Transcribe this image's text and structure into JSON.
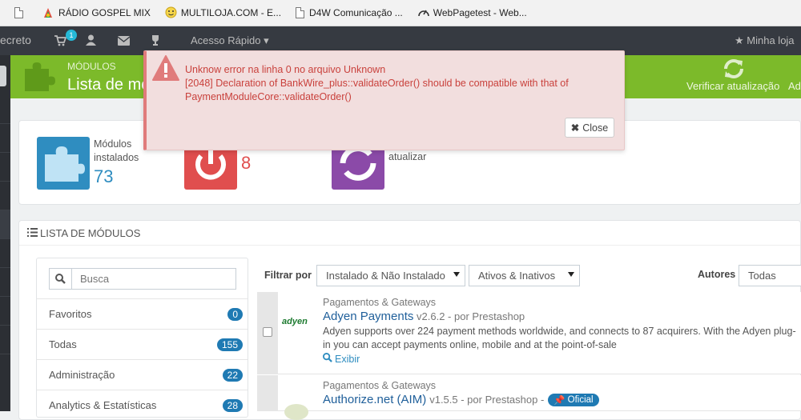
{
  "bookmarks": [
    {
      "label": "",
      "icon": "page-icon"
    },
    {
      "label": "RÁDIO GOSPEL MIX",
      "icon": "colorful-leaf-icon"
    },
    {
      "label": "MULTILOJA.COM - E...",
      "icon": "smiley-icon"
    },
    {
      "label": "D4W Comunicação ...",
      "icon": "page-icon"
    },
    {
      "label": "WebPagetest - Web...",
      "icon": "speedometer-icon"
    }
  ],
  "topbar": {
    "brand_fragment": "ecreto",
    "cart_count": "1",
    "quick_access": "Acesso Rápido",
    "my_store": "Minha loja"
  },
  "header": {
    "breadcrumb": "MÓDULOS",
    "title": "Lista de mó",
    "check_update": "Verificar atualização",
    "add_fragment": "Ad"
  },
  "kpis": [
    {
      "label_line1": "Módulos",
      "label_line2": "instalados",
      "value": "73",
      "color": "#2f8dc0"
    },
    {
      "label_line1": "",
      "label_line2": "",
      "value": "8",
      "color": "#e04e4e"
    },
    {
      "label_line1": "",
      "label_line2": "atualizar",
      "value": "",
      "color": "#8b4aa8"
    }
  ],
  "module_list": {
    "title": "LISTA DE MÓDULOS",
    "search_placeholder": "Busca",
    "categories": [
      {
        "name": "Favoritos",
        "count": "0"
      },
      {
        "name": "Todas",
        "count": "155"
      },
      {
        "name": "Administração",
        "count": "22"
      },
      {
        "name": "Analytics & Estatísticas",
        "count": "28"
      }
    ],
    "filter_label": "Filtrar por",
    "filter_install": "Instalado & Não Instalado",
    "filter_active": "Ativos & Inativos",
    "authors_label": "Autores",
    "authors_value": "Todas",
    "modules": [
      {
        "category": "Pagamentos & Gateways",
        "name": "Adyen Payments",
        "version": "v2.6.2 - por Prestashop",
        "desc_line1": "Adyen supports over 224 payment methods worldwide, and connects to 87 acquirers. With the Adyen plug-",
        "desc_line2": "in you can accept payments online, mobile and at the point-of-sale",
        "action": "Exibir",
        "logo": "adyen"
      },
      {
        "category": "Pagamentos & Gateways",
        "name": "Authorize.net (AIM)",
        "version": "v1.5.5 - por Prestashop -",
        "badge": "Oficial"
      }
    ]
  },
  "error": {
    "line1": "Unknow error na linha 0 no arquivo Unknown",
    "line2": "[2048] Declaration of BankWire_plus::validateOrder() should be compatible with that of",
    "line3": "PaymentModuleCore::validateOrder()",
    "close_label": "Close"
  }
}
